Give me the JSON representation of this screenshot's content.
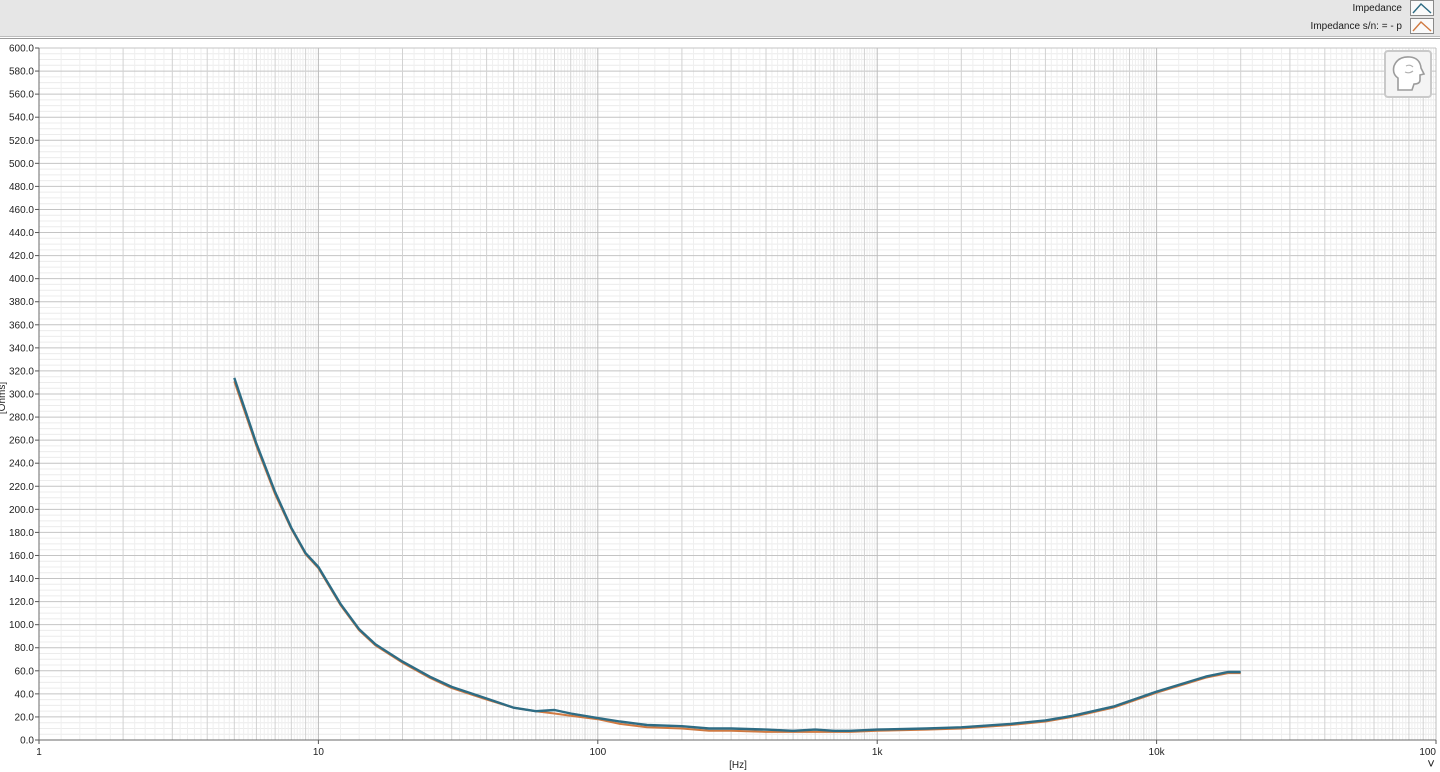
{
  "legend": [
    {
      "label": "Impedance",
      "color": "#2e6c84"
    },
    {
      "label": "Impedance s/n: = - p",
      "color": "#d07a42"
    }
  ],
  "icons": {
    "logo": "head-logo-icon",
    "expand": "chevron-down-icon"
  },
  "chart_data": {
    "type": "line",
    "xlabel": "[Hz]",
    "ylabel": "[Ohms]",
    "x_scale": "log",
    "xlim": [
      1,
      100000
    ],
    "ylim": [
      0,
      600
    ],
    "grid": true,
    "legend_position": "top-right",
    "x_ticks": [
      {
        "value": 1,
        "label": "1"
      },
      {
        "value": 10,
        "label": "10"
      },
      {
        "value": 100,
        "label": "100"
      },
      {
        "value": 1000,
        "label": "1k"
      },
      {
        "value": 10000,
        "label": "10k"
      },
      {
        "value": 100000,
        "label": "100"
      }
    ],
    "y_ticks": [
      "0.0",
      "20.0",
      "40.0",
      "60.0",
      "80.0",
      "100.0",
      "120.0",
      "140.0",
      "160.0",
      "180.0",
      "200.0",
      "220.0",
      "240.0",
      "260.0",
      "280.0",
      "300.0",
      "320.0",
      "340.0",
      "360.0",
      "380.0",
      "400.0",
      "420.0",
      "440.0",
      "460.0",
      "480.0",
      "500.0",
      "520.0",
      "540.0",
      "560.0",
      "580.0",
      "600.0"
    ],
    "series": [
      {
        "name": "Impedance",
        "color": "#2e6c84",
        "x": [
          5,
          6,
          7,
          8,
          9,
          10,
          12,
          14,
          16,
          20,
          25,
          30,
          40,
          50,
          60,
          70,
          80,
          100,
          120,
          150,
          200,
          250,
          300,
          400,
          500,
          600,
          700,
          800,
          1000,
          1500,
          2000,
          3000,
          4000,
          5000,
          7000,
          10000,
          15000,
          18000,
          20000
        ],
        "y": [
          314,
          257,
          215,
          184,
          162,
          150,
          118,
          96,
          83,
          68,
          55,
          46,
          36,
          28,
          25,
          26,
          23,
          19,
          16,
          13,
          12,
          10,
          10,
          9,
          8,
          9,
          8,
          8,
          9,
          10,
          11,
          14,
          17,
          21,
          29,
          42,
          55,
          59,
          59
        ]
      },
      {
        "name": "Impedance s/n: = - p",
        "color": "#d07a42",
        "x": [
          5,
          6,
          7,
          8,
          9,
          10,
          12,
          14,
          16,
          20,
          25,
          30,
          40,
          50,
          60,
          70,
          80,
          100,
          120,
          150,
          200,
          250,
          300,
          400,
          500,
          600,
          700,
          800,
          1000,
          1500,
          2000,
          3000,
          4000,
          5000,
          7000,
          10000,
          15000,
          18000,
          20000
        ],
        "y": [
          311,
          255,
          213,
          183,
          161,
          149,
          117,
          95,
          82,
          67,
          54,
          45,
          35,
          28,
          25,
          23,
          21,
          18,
          14,
          11,
          10,
          8,
          8,
          7,
          7,
          7,
          7,
          7,
          8,
          9,
          10,
          13,
          16,
          20,
          28,
          41,
          54,
          58,
          58
        ]
      }
    ]
  }
}
